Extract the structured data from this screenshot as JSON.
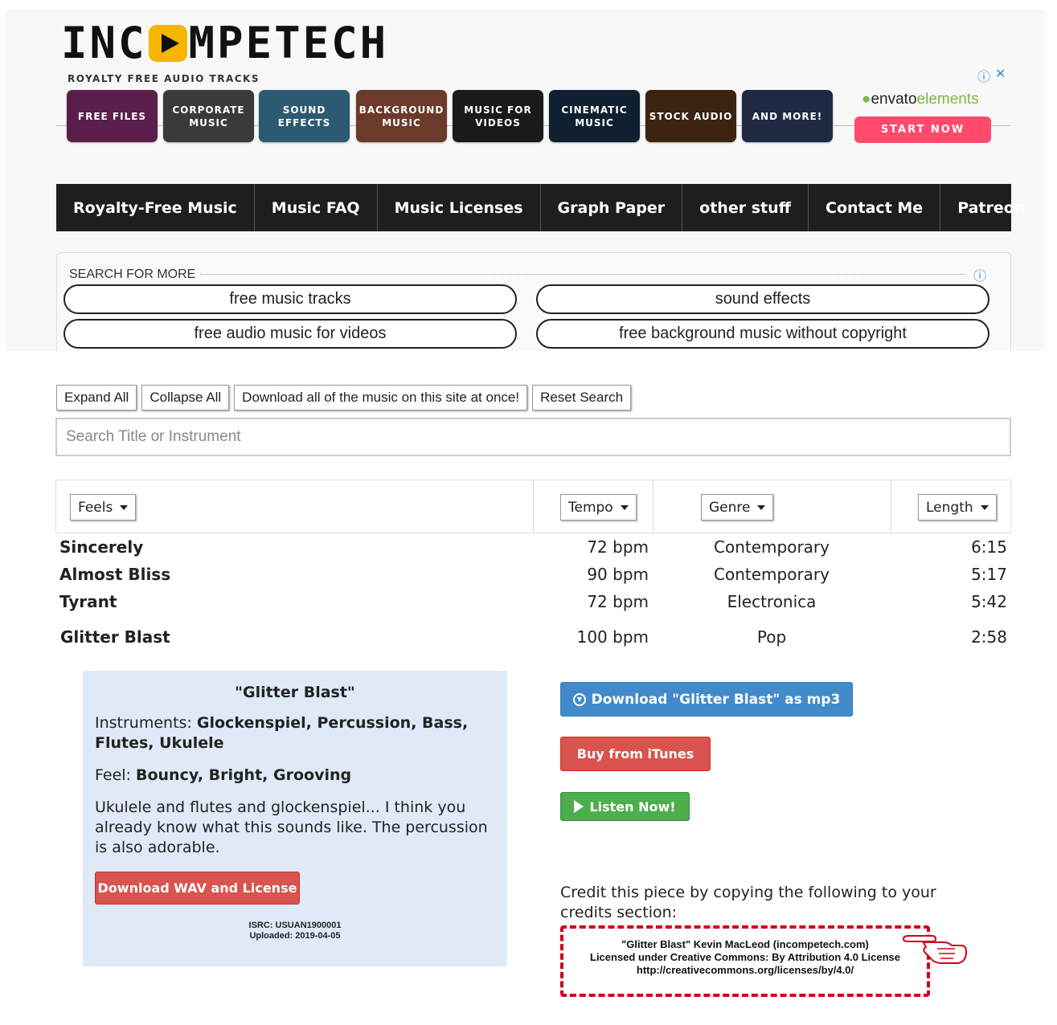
{
  "ad": {
    "logo_left": "INC",
    "logo_right": "MPETECH",
    "tagline": "ROYALTY FREE AUDIO TRACKS",
    "tiles": [
      {
        "label": "FREE FILES",
        "color": "#5b1e4a"
      },
      {
        "label": "CORPORATE MUSIC",
        "color": "#3a3a3a"
      },
      {
        "label": "SOUND EFFECTS",
        "color": "#2d5a73"
      },
      {
        "label": "BACKGROUND MUSIC",
        "color": "#6b3a2a"
      },
      {
        "label": "MUSIC FOR VIDEOS",
        "color": "#1a1a1a"
      },
      {
        "label": "CINEMATIC MUSIC",
        "color": "#0f2030"
      },
      {
        "label": "STOCK AUDIO",
        "color": "#3a2410"
      },
      {
        "label": "AND MORE!",
        "color": "#1e2a44"
      }
    ],
    "brand_envato": "envato",
    "brand_elements": "elements",
    "cta": "START NOW",
    "info_icon": "info-icon",
    "close_icon": "close-icon"
  },
  "nav": {
    "items": [
      "Royalty-Free Music",
      "Music FAQ",
      "Music Licenses",
      "Graph Paper",
      "other stuff",
      "Contact Me",
      "Patreon"
    ]
  },
  "search_more": {
    "title": "SEARCH FOR MORE",
    "pills": [
      "free music tracks",
      "sound effects",
      "free audio music for videos",
      "free background music without copyright"
    ]
  },
  "controls": {
    "expand": "Expand All",
    "collapse": "Collapse All",
    "download_all": "Download all of the music on this site at once!",
    "reset": "Reset Search",
    "search_placeholder": "Search Title or Instrument"
  },
  "filters": {
    "feels": "Feels",
    "tempo": "Tempo",
    "genre": "Genre",
    "length": "Length"
  },
  "tracks": [
    {
      "title": "Sincerely",
      "tempo": "72 bpm",
      "genre": "Contemporary",
      "length": "6:15"
    },
    {
      "title": "Almost Bliss",
      "tempo": "90 bpm",
      "genre": "Contemporary",
      "length": "5:17"
    },
    {
      "title": "Tyrant",
      "tempo": "72 bpm",
      "genre": "Electronica",
      "length": "5:42"
    },
    {
      "title": "Glitter Blast",
      "tempo": "100 bpm",
      "genre": "Pop",
      "length": "2:58"
    }
  ],
  "detail": {
    "title": "\"Glitter Blast\"",
    "instruments_label": "Instruments: ",
    "instruments": "Glockenspiel, Percussion, Bass, Flutes, Ukulele",
    "feel_label": "Feel: ",
    "feel": "Bouncy, Bright, Grooving",
    "description": "Ukulele and flutes and glockenspiel... I think you already know what this sounds like. The percussion is also adorable.",
    "wav_button": "Download WAV and License",
    "isrc": "ISRC: USUAN1900001",
    "uploaded": "Uploaded: 2019-04-05",
    "download_mp3": "Download \"Glitter Blast\" as mp3",
    "itunes": "Buy from iTunes",
    "listen": "Listen Now!",
    "credit_intro": "Credit this piece by copying the following to your credits section:",
    "credit_lines": [
      "\"Glitter Blast\" Kevin MacLeod (incompetech.com)",
      "Licensed under Creative Commons: By Attribution 4.0 License",
      "http://creativecommons.org/licenses/by/4.0/"
    ],
    "pointer_icon": "pointing-hand-icon"
  }
}
